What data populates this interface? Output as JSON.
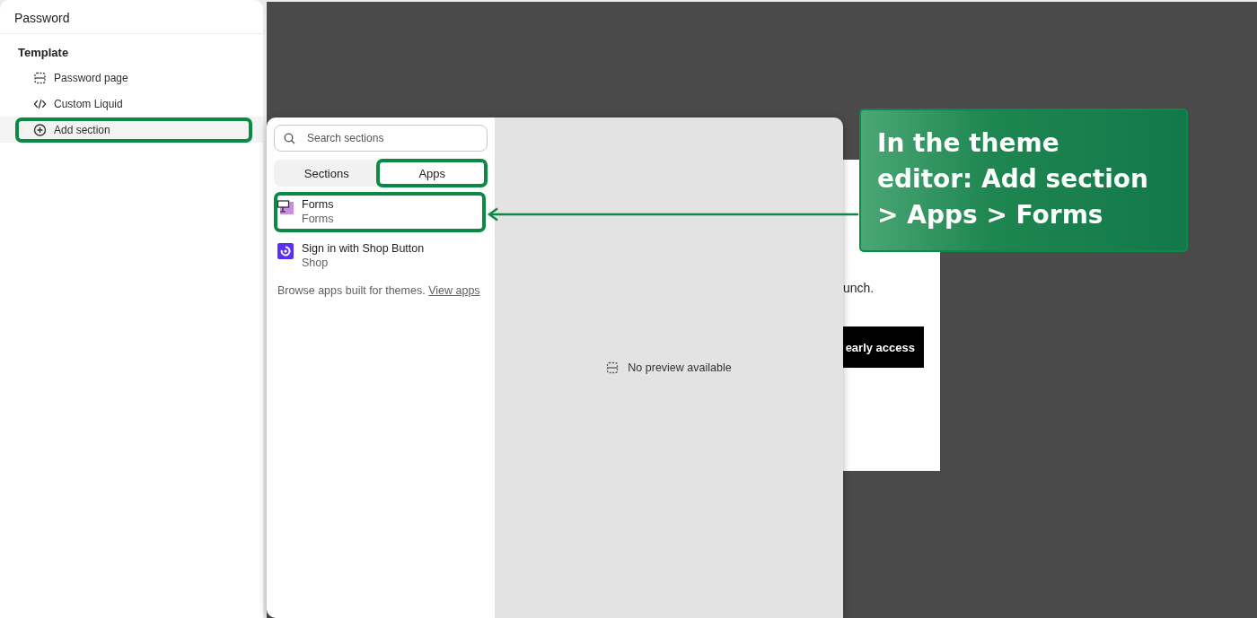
{
  "sidebar": {
    "title": "Password",
    "group": "Template",
    "items": [
      {
        "label": "Password page",
        "highlighted": false
      },
      {
        "label": "Custom Liquid",
        "highlighted": false
      },
      {
        "label": "Add section",
        "highlighted": true
      }
    ]
  },
  "background_page": {
    "text": "unch.",
    "button": "early access"
  },
  "popup": {
    "search": {
      "placeholder": "Search sections"
    },
    "tabs": [
      {
        "label": "Sections",
        "selected": false,
        "highlighted": false
      },
      {
        "label": "Apps",
        "selected": true,
        "highlighted": true
      }
    ],
    "apps": [
      {
        "name": "Forms",
        "vendor": "Forms",
        "highlighted": true
      },
      {
        "name": "Sign in with Shop Button",
        "vendor": "Shop",
        "highlighted": false
      }
    ],
    "footer": {
      "text": "Browse apps built for themes.",
      "link": "View apps"
    },
    "preview_message": "No preview available"
  },
  "callout": {
    "lines": [
      "In the theme",
      "editor: Add section",
      "> Apps > Forms"
    ]
  }
}
